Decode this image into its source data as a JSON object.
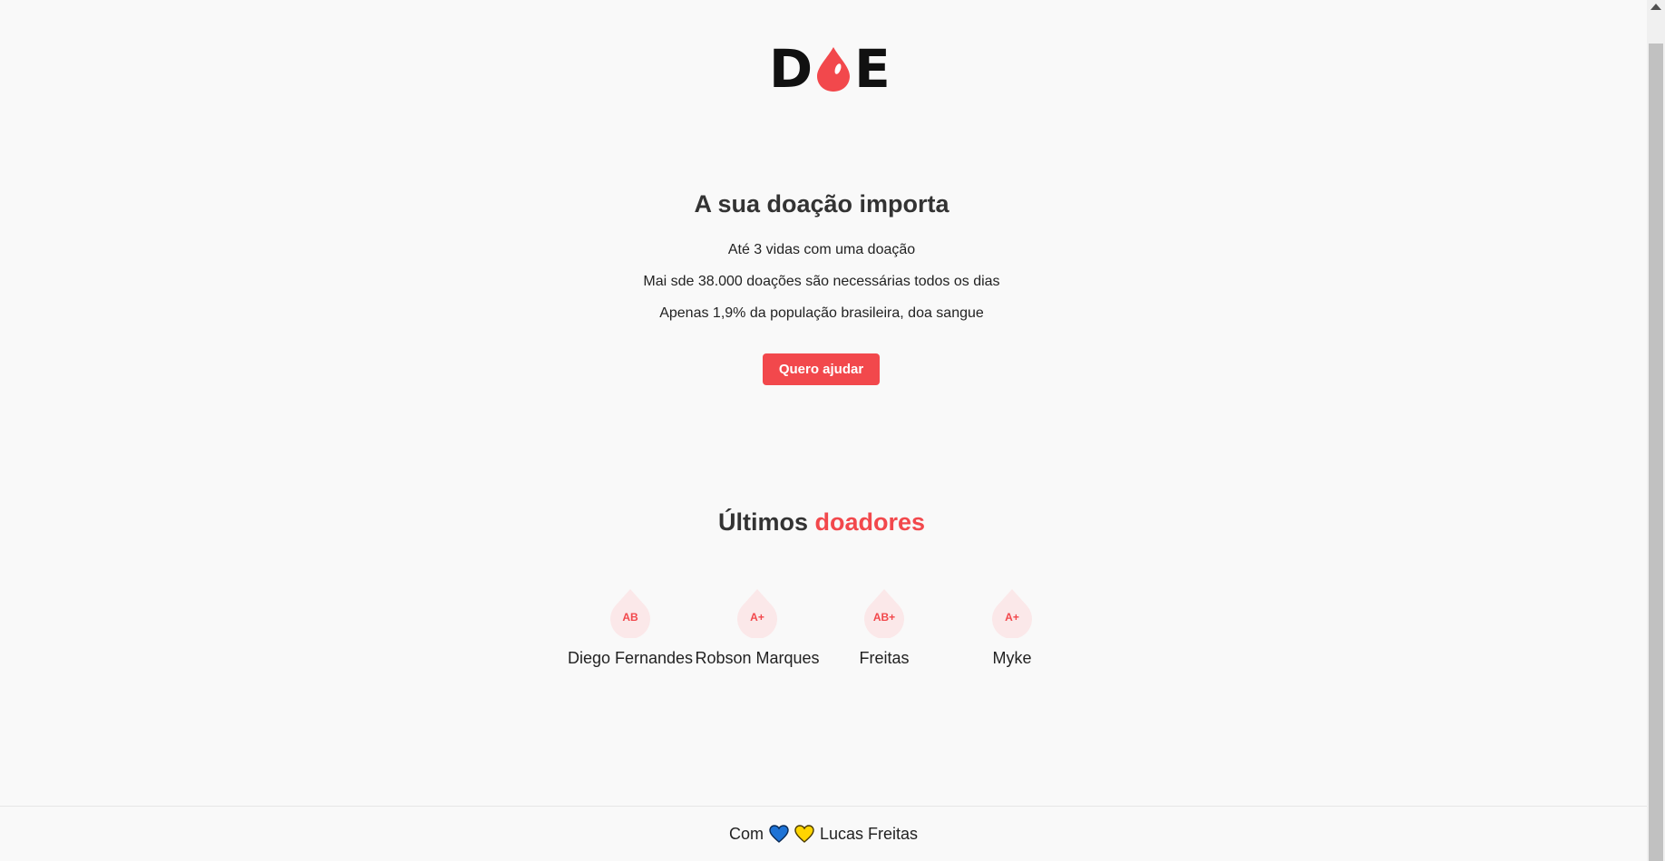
{
  "logo": {
    "letter_left": "D",
    "letter_right": "E",
    "drop_color": "#f2484c"
  },
  "hero": {
    "title": "A sua doação importa",
    "lines": [
      "Até 3 vidas com uma doação",
      "Mai sde 38.000 doações são necessárias todos os dias",
      "Apenas 1,9% da população brasileira, doa sangue"
    ],
    "cta_label": "Quero ajudar"
  },
  "donors": {
    "title_prefix": "Últimos",
    "title_accent": "doadores",
    "list": [
      {
        "blood_type": "AB",
        "name": "Diego Fernandes"
      },
      {
        "blood_type": "A+",
        "name": "Robson Marques"
      },
      {
        "blood_type": "AB+",
        "name": "Freitas"
      },
      {
        "blood_type": "A+",
        "name": "Myke"
      }
    ]
  },
  "footer": {
    "prefix": "Com",
    "author": "Lucas Freitas",
    "heart_colors": [
      "#1e73d6",
      "#ffd500"
    ]
  },
  "colors": {
    "accent": "#f2484c",
    "background": "#f9f9f9",
    "drop_light": "#fbe8e9"
  }
}
